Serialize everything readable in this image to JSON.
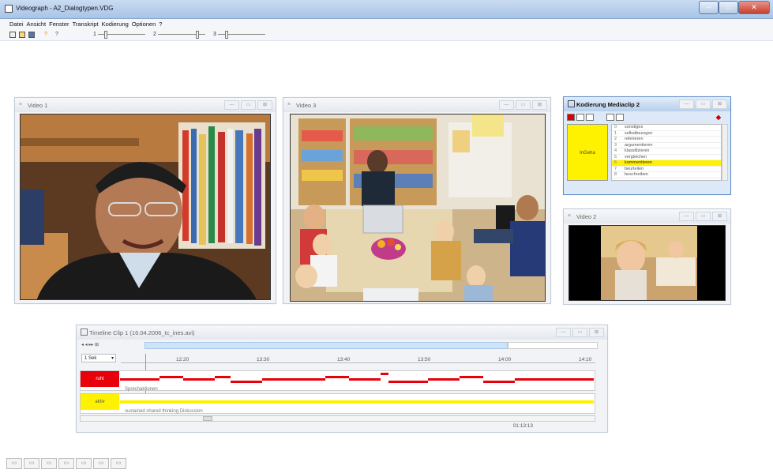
{
  "app": {
    "title": "Videograph - A2_Dialogtypen.VDG",
    "window_controls": [
      "–",
      "□",
      "✕"
    ]
  },
  "menu": [
    "Datei",
    "Ansicht",
    "Fenster",
    "Transkript",
    "Kodierung",
    "Optionen",
    "?"
  ],
  "toolbar": {
    "slider_labels": [
      "1",
      "2",
      "3"
    ]
  },
  "windows": {
    "video1": {
      "title": "Video 1"
    },
    "video3": {
      "title": "Video 3"
    },
    "video2": {
      "title": "Video 2"
    },
    "kodierung": {
      "title": "Kodierung Mediaclip 2",
      "code_box_label": "InGeha",
      "codes": [
        {
          "num": "0",
          "label": "sonstiges"
        },
        {
          "num": "1",
          "label": "selbstbezogen"
        },
        {
          "num": "2",
          "label": "referieren"
        },
        {
          "num": "3",
          "label": "argumentieren"
        },
        {
          "num": "4",
          "label": "klassifizieren"
        },
        {
          "num": "5",
          "label": "vergleichen"
        },
        {
          "num": "6",
          "label": "kommentieren",
          "selected": true
        },
        {
          "num": "7",
          "label": "beurteilen"
        },
        {
          "num": "8",
          "label": "beschreiben"
        }
      ]
    },
    "timeline": {
      "title": "Timeline Clip 1 (16.04.2006_tc_ines.avi)",
      "speed": "1 Sek",
      "ticks": [
        "12:20",
        "13:30",
        "13:40",
        "13:50",
        "14:00",
        "14:10"
      ],
      "tracks": [
        {
          "label": "ruht",
          "color": "#e8000b",
          "sublabel": "Sprechaktionen"
        },
        {
          "label": "aktiv",
          "color": "#fff200",
          "sublabel": "sustained shared thinking Diskussion"
        }
      ],
      "timecode": "01:13:13"
    }
  },
  "colors": {
    "accent": "#5f8ec7",
    "red_track": "#e8000b",
    "yellow_track": "#fff200"
  }
}
